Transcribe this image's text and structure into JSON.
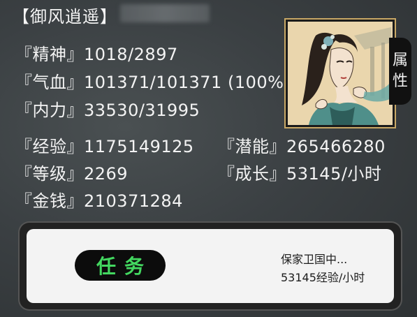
{
  "header": {
    "name": "【御风逍遥】"
  },
  "stats": {
    "spirit": {
      "label": "『精神』",
      "value": "1018/2897"
    },
    "hp": {
      "label": "『气血』",
      "value": "101371/101371 (100%"
    },
    "inner": {
      "label": "『内力』",
      "value": "33530/31995"
    },
    "exp": {
      "label": "『经验』",
      "value": "1175149125"
    },
    "potential": {
      "label": "『潜能』",
      "value": "265466280"
    },
    "level": {
      "label": "『等级』",
      "value": "2269"
    },
    "growth": {
      "label": "『成长』",
      "value": "53145/小时"
    },
    "money": {
      "label": "『金钱』",
      "value": "210371284"
    }
  },
  "attr_tab": {
    "line1": "属",
    "line2": "性"
  },
  "task": {
    "button_label": "任务",
    "status": "保家卫国中...",
    "rate": "53145经验/小时"
  },
  "colors": {
    "background": "#3a3f42",
    "task_button_text": "#43d860",
    "portrait_border": "#c9a865"
  }
}
